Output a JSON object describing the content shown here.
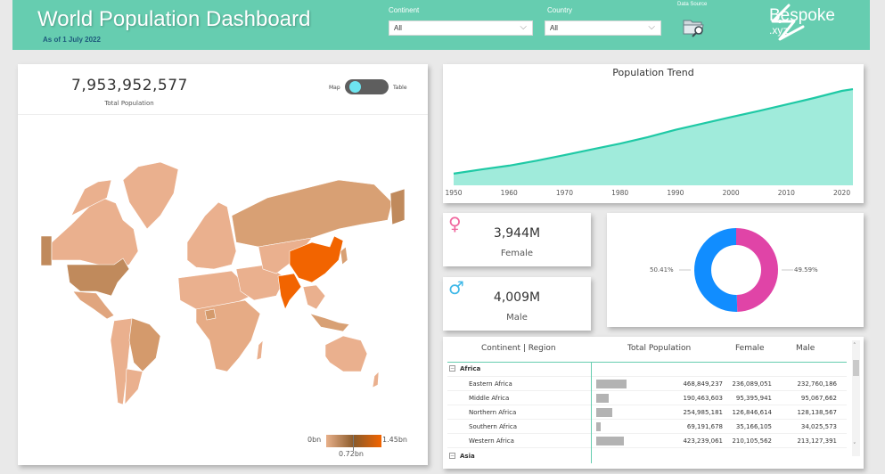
{
  "header": {
    "title": "World Population Dashboard",
    "subtitle": "As of 1 July 2022",
    "continent_label": "Continent",
    "continent_value": "All",
    "country_label": "Country",
    "country_value": "All",
    "data_source_label": "Data Source",
    "logo_text": "Bespoke",
    "logo_sub": ".xyz",
    "brand_color": "#66cdb0"
  },
  "map_panel": {
    "total_population": "7,953,952,577",
    "total_population_label": "Total Population",
    "toggle_left": "Map",
    "toggle_right": "Table",
    "toggle_state": "Map",
    "legend_min": "0bn",
    "legend_mid": "0.72bn",
    "legend_max": "1.45bn",
    "legend_colors": [
      "#e8b08a",
      "#8a5a2a",
      "#f26400"
    ]
  },
  "trend": {
    "title": "Population Trend"
  },
  "gender": {
    "female_value": "3,944M",
    "female_label": "Female",
    "female_icon": "♀",
    "male_value": "4,009M",
    "male_label": "Male",
    "male_icon": "♂",
    "male_pct": "50.41%",
    "female_pct": "49.59%",
    "male_color": "#118dff",
    "female_color": "#e044a7"
  },
  "table": {
    "headers": [
      "Continent | Region",
      "Total Population",
      "Female",
      "Male"
    ],
    "groups": [
      {
        "name": "Africa",
        "expanded": true,
        "rows": [
          {
            "region": "Eastern Africa",
            "total": "468,849,237",
            "female": "236,089,051",
            "male": "232,760,186",
            "total_num": 468849237
          },
          {
            "region": "Middle Africa",
            "total": "190,463,603",
            "female": "95,395,941",
            "male": "95,067,662",
            "total_num": 190463603
          },
          {
            "region": "Northern Africa",
            "total": "254,985,181",
            "female": "126,846,614",
            "male": "128,138,567",
            "total_num": 254985181
          },
          {
            "region": "Southern Africa",
            "total": "69,191,678",
            "female": "35,166,105",
            "male": "34,025,573",
            "total_num": 69191678
          },
          {
            "region": "Western Africa",
            "total": "423,239,061",
            "female": "210,105,562",
            "male": "213,127,391",
            "total_num": 423239061
          }
        ]
      },
      {
        "name": "Asia",
        "expanded": false,
        "rows": []
      }
    ]
  },
  "chart_data": [
    {
      "type": "area",
      "title": "Population Trend",
      "xlabel": "",
      "ylabel": "",
      "x_ticks": [
        "1950",
        "1960",
        "1970",
        "1980",
        "1990",
        "2000",
        "2010",
        "2020"
      ],
      "x": [
        1950,
        1955,
        1960,
        1965,
        1970,
        1975,
        1980,
        1985,
        1990,
        1995,
        2000,
        2005,
        2010,
        2015,
        2020,
        2022
      ],
      "values": [
        2.5,
        2.77,
        3.02,
        3.34,
        3.7,
        4.07,
        4.44,
        4.86,
        5.33,
        5.74,
        6.15,
        6.54,
        6.96,
        7.38,
        7.84,
        7.95
      ],
      "y_unit": "billion",
      "ylim": [
        1.75,
        8.3
      ],
      "line_color": "#1fc9a5",
      "fill_color": "#a0ebdb",
      "grid": false
    },
    {
      "type": "pie",
      "title": "",
      "categories": [
        "Male",
        "Female"
      ],
      "values": [
        50.41,
        49.59
      ],
      "labels": [
        "50.41%",
        "49.59%"
      ],
      "colors": [
        "#118dff",
        "#e044a7"
      ],
      "donut": true
    }
  ]
}
